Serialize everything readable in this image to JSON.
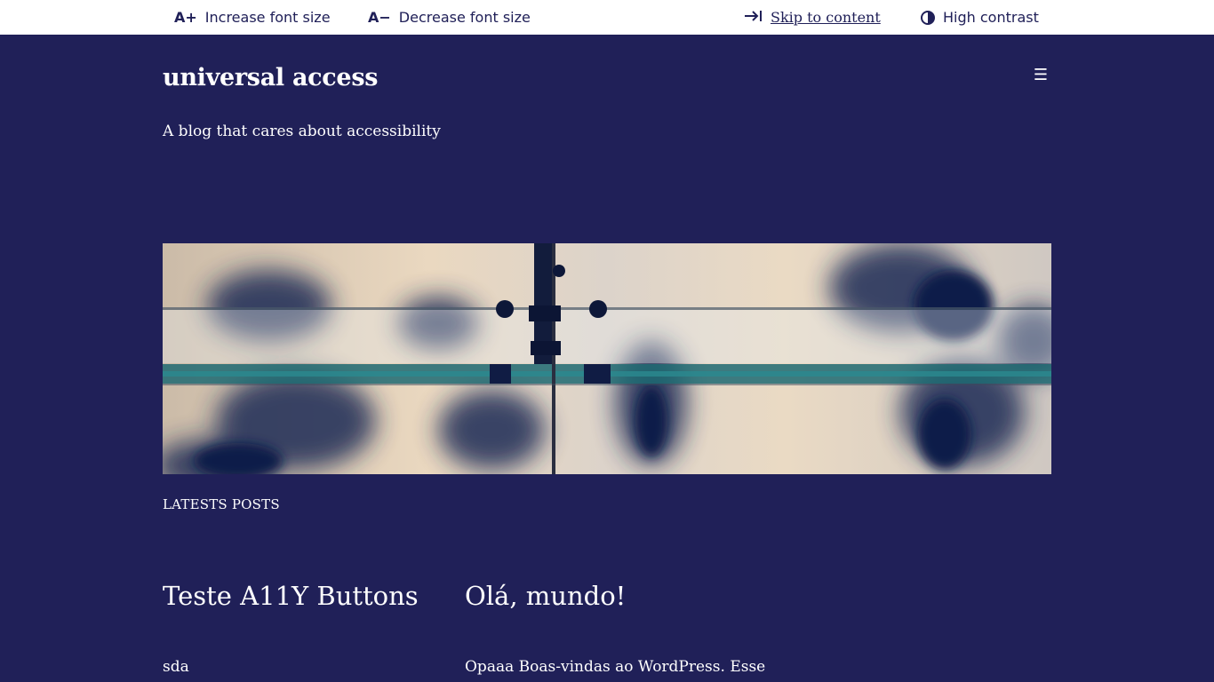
{
  "toolbar": {
    "increase": {
      "icon_text": "A+",
      "label": "Increase font size"
    },
    "decrease": {
      "icon_text": "A−",
      "label": "Decrease font size"
    },
    "skip": {
      "icon_text": "⇥",
      "label": "Skip to content"
    },
    "contrast": {
      "label": "High contrast"
    }
  },
  "header": {
    "site_title": "universal access",
    "tagline": "A blog that cares about accessibility",
    "menu_icon": "☰"
  },
  "main": {
    "section_heading": "LATESTS POSTS",
    "posts": [
      {
        "title": "Teste A11Y Buttons",
        "excerpt": "sda"
      },
      {
        "title": "Olá, mundo!",
        "excerpt": "Opaaa Boas-vindas ao WordPress. Esse"
      }
    ]
  },
  "colors": {
    "background": "#202058",
    "toolbar_background": "#ffffff",
    "text": "#ffffff"
  },
  "icons": {
    "increase": "text-size-increase-icon",
    "decrease": "text-size-decrease-icon",
    "skip": "skip-arrow-icon",
    "contrast": "contrast-icon",
    "menu": "hamburger-menu-icon"
  }
}
